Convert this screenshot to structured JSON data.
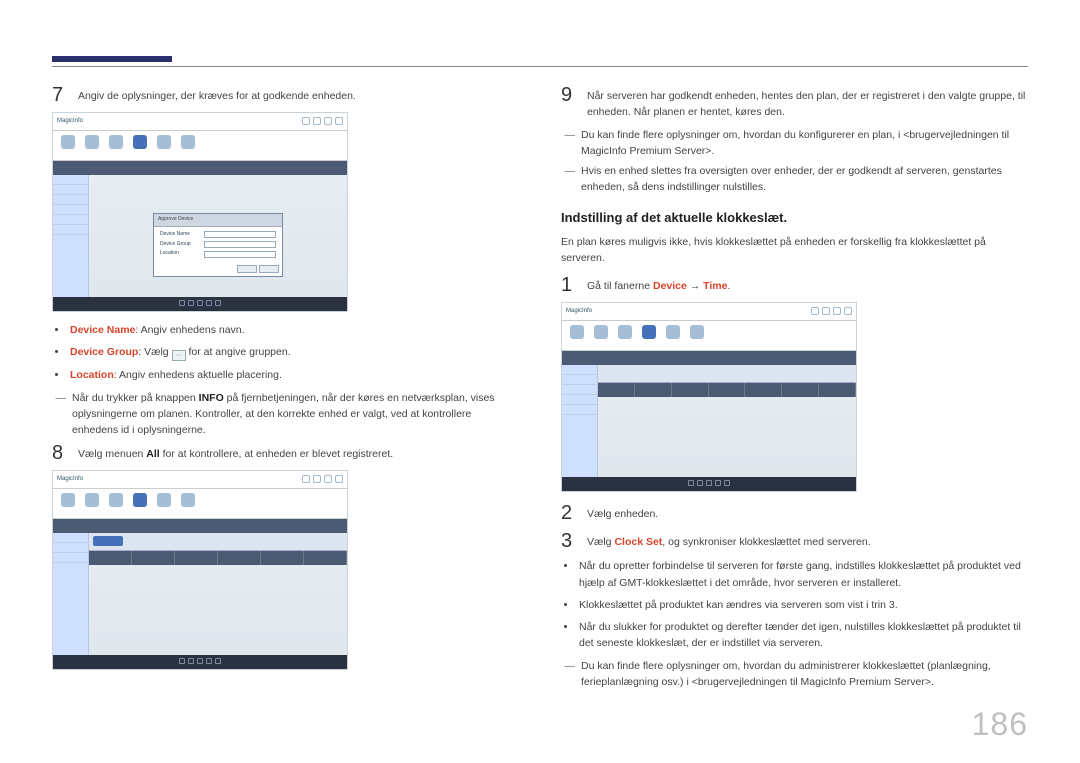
{
  "page_number": "186",
  "heading": "Indstilling af det aktuelle klokkeslæt.",
  "heading_sub": "En plan køres muligvis ikke, hvis klokkeslættet på enheden er forskellig fra klokkeslættet på serveren.",
  "left": {
    "step7": "Angiv de oplysninger, der kræves for at godkende enheden.",
    "b1_label": "Device Name",
    "b1_text": ": Angiv enhedens navn.",
    "b2_label": "Device Group",
    "b2_text_a": ": Vælg ",
    "b2_text_b": " for at angive gruppen.",
    "b3_label": "Location",
    "b3_text": ": Angiv enhedens aktuelle placering.",
    "dash1_a": "Når du trykker på knappen ",
    "dash1_bold": "INFO",
    "dash1_b": " på fjernbetjeningen, når der køres en netværksplan, vises oplysningerne om planen. Kontroller, at den korrekte enhed er valgt, ved at kontrollere enhedens id i oplysningerne.",
    "step8_a": "Vælg menuen ",
    "step8_bold": "All",
    "step8_b": " for at kontrollere, at enheden er blevet registreret."
  },
  "right": {
    "step9": "Når serveren har godkendt enheden, hentes den plan, der er registreret i den valgte gruppe, til enheden. Når planen er hentet, køres den.",
    "dash1": "Du kan finde flere oplysninger om, hvordan du konfigurerer en plan, i <brugervejledningen til MagicInfo Premium Server>.",
    "dash2": "Hvis en enhed slettes fra oversigten over enheder, der er godkendt af serveren, genstartes enheden, så dens indstillinger nulstilles.",
    "step1_a": "Gå til fanerne ",
    "step1_red1": "Device",
    "step1_arrow": " → ",
    "step1_red2": "Time",
    "step1_dot": ".",
    "step2": "Vælg enheden.",
    "step3_a": "Vælg ",
    "step3_red": "Clock Set",
    "step3_b": ", og synkroniser klokkeslættet med serveren.",
    "b1": "Når du opretter forbindelse til serveren for første gang, indstilles klokkeslættet på produktet ved hjælp af GMT-klokkeslættet i det område, hvor serveren er installeret.",
    "b2": "Klokkeslættet på produktet kan ændres via serveren som vist i trin 3.",
    "b3": "Når du slukker for produktet og derefter tænder det igen, nulstilles klokkeslættet på produktet til det seneste klokkeslæt, der er indstillet via serveren.",
    "dash3": "Du kan finde flere oplysninger om, hvordan du administrerer klokkeslættet (planlægning, ferieplanlægning osv.) i <brugervejledningen til MagicInfo Premium Server>."
  },
  "shot": {
    "brand": "MagicInfo",
    "dlg_hdr": "Approve Device",
    "dlg_l1": "Device Name",
    "dlg_l2": "Device Group",
    "dlg_l3": "Location"
  }
}
